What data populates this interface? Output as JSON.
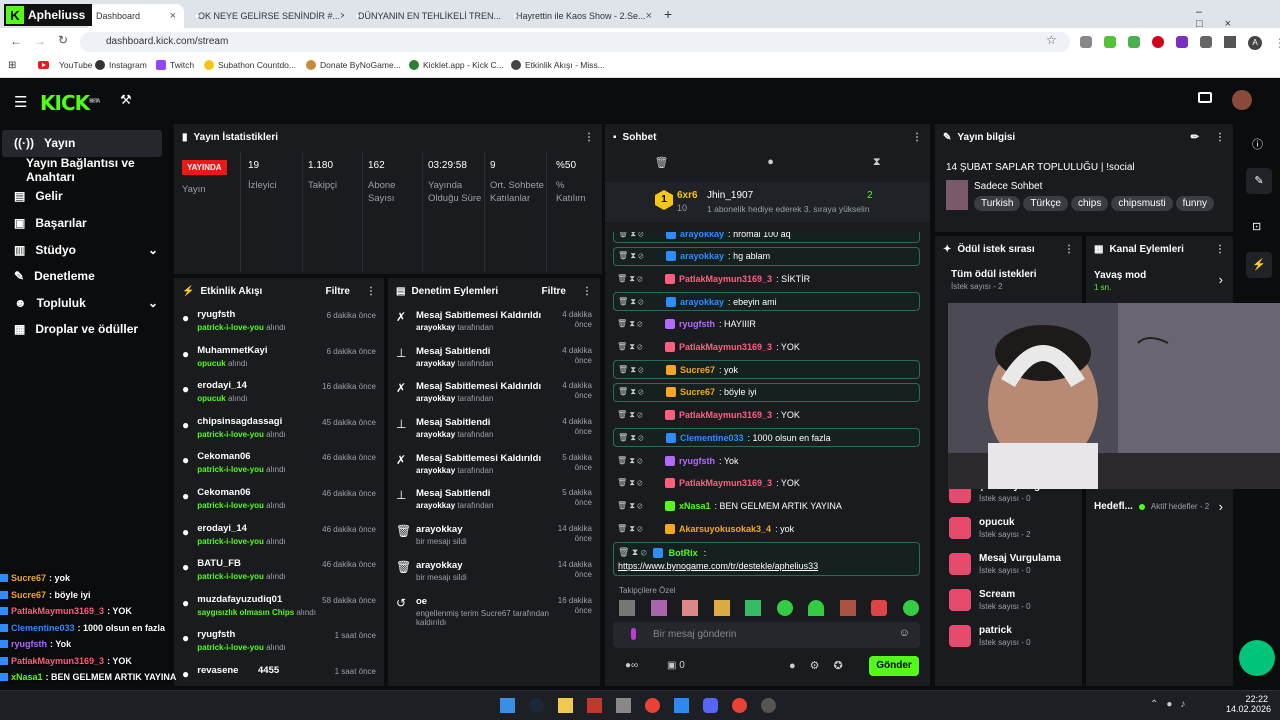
{
  "browser": {
    "tabs": [
      {
        "label": "Dashboard",
        "channel_badge": "Apheliuss",
        "active": true
      },
      {
        "label": "OK NEYE GELİRSE SENİNDİR #..."
      },
      {
        "label": "DÜNYANIN EN TEHLİKELİ TREN..."
      },
      {
        "label": "Hayrettin ile Kaos Show - 2.Se..."
      }
    ],
    "url": "dashboard.kick.com/stream",
    "bookmarks": [
      "YouTube",
      "Instagram",
      "Twitch",
      "Subathon Countdo...",
      "Donate ByNoGame...",
      "Kicklet.app - Kick C...",
      "Etkinlik Akışı - Miss..."
    ]
  },
  "kick": {
    "logo": "KICK",
    "beta": "BETA"
  },
  "nav": [
    {
      "label": "Yayın",
      "icon": "broadcast-icon",
      "active": true
    },
    {
      "label": "Yayın Bağlantısı ve Anahtarı",
      "icon": ""
    },
    {
      "label": "Gelir",
      "icon": "revenue-icon"
    },
    {
      "label": "Başarılar",
      "icon": "trophy-icon"
    },
    {
      "label": "Stüdyo",
      "icon": "studio-icon",
      "expand": true
    },
    {
      "label": "Denetleme",
      "icon": "wrench-icon"
    },
    {
      "label": "Topluluk",
      "icon": "users-icon",
      "expand": true
    },
    {
      "label": "Droplar ve ödüller",
      "icon": "gift-icon"
    }
  ],
  "stats": {
    "title": "Yayın İstatistikleri",
    "live_badge": "YAYINDA",
    "live_label": "Yayın",
    "items": [
      {
        "value": "19",
        "label": "İzleyici"
      },
      {
        "value": "1.180",
        "label": "Takipçi"
      },
      {
        "value": "162",
        "label": "Abone Sayısı"
      },
      {
        "value": "03:29:58",
        "label": "Yayında Olduğu Süre"
      },
      {
        "value": "9",
        "label": "Ort. Sohbete Katılanlar"
      },
      {
        "value": "%50",
        "label": "% Katılım"
      }
    ]
  },
  "activity": {
    "title": "Etkinlik Akışı",
    "filter": "Filtre",
    "items": [
      {
        "name": "ryugfsth",
        "reward": "patrick-i-love-you",
        "suffix": "alındı",
        "time": "6 dakika önce"
      },
      {
        "name": "MuhammetKayi",
        "reward": "opucuk",
        "suffix": "alındı",
        "time": "6 dakika önce"
      },
      {
        "name": "erodayi_14",
        "reward": "opucuk",
        "suffix": "alındı",
        "time": "16 dakika önce"
      },
      {
        "name": "chipsinsagdassagi",
        "reward": "patrick-i-love-you",
        "suffix": "alındı",
        "time": "45 dakika önce"
      },
      {
        "name": "Cekoman06",
        "reward": "patrick-i-love-you",
        "suffix": "alındı",
        "time": "46 dakika önce"
      },
      {
        "name": "Cekoman06",
        "reward": "patrick-i-love-you",
        "suffix": "alındı",
        "time": "46 dakika önce"
      },
      {
        "name": "erodayi_14",
        "reward": "patrick-i-love-you",
        "suffix": "alındı",
        "time": "46 dakika önce"
      },
      {
        "name": "BATU_FB",
        "reward": "patrick-i-love-you",
        "suffix": "alındı",
        "time": "46 dakika önce"
      },
      {
        "name": "muzdafayuzudiq01",
        "reward": "saygısızlık olmasın Chips",
        "suffix": "alındı",
        "time": "58 dakika önce"
      },
      {
        "name": "ryugfsth",
        "reward": "patrick-i-love-you",
        "suffix": "alındı",
        "time": "1 saat önce"
      },
      {
        "name": "revasene",
        "extra": "4455",
        "reward": "",
        "suffix": "",
        "time": "1 saat önce"
      }
    ]
  },
  "moderation": {
    "title": "Denetim Eylemleri",
    "filter": "Filtre",
    "items": [
      {
        "action": "Mesaj Sabitlemesi Kaldırıldı",
        "by": "arayokkay",
        "suffix": "tarafından",
        "time": "4 dakika önce",
        "icon": "unpin-icon"
      },
      {
        "action": "Mesaj Sabitlendi",
        "by": "arayokkay",
        "suffix": "tarafından",
        "time": "4 dakika önce",
        "icon": "pin-icon"
      },
      {
        "action": "Mesaj Sabitlemesi Kaldırıldı",
        "by": "arayokkay",
        "suffix": "tarafından",
        "time": "4 dakika önce",
        "icon": "unpin-icon"
      },
      {
        "action": "Mesaj Sabitlendi",
        "by": "arayokkay",
        "suffix": "tarafından",
        "time": "4 dakika önce",
        "icon": "pin-icon"
      },
      {
        "action": "Mesaj Sabitlemesi Kaldırıldı",
        "by": "arayokkay",
        "suffix": "tarafından",
        "time": "5 dakika önce",
        "icon": "unpin-icon"
      },
      {
        "action": "Mesaj Sabitlendi",
        "by": "arayokkay",
        "suffix": "tarafından",
        "time": "5 dakika önce",
        "icon": "pin-icon"
      },
      {
        "action": "arayokkay",
        "by": "",
        "suffix": "bir mesajı sildi",
        "time": "14 dakika önce",
        "icon": "trash-icon"
      },
      {
        "action": "arayokkay",
        "by": "",
        "suffix": "bir mesajı sildi",
        "time": "14 dakika önce",
        "icon": "trash-icon"
      },
      {
        "action": "oe",
        "by": "",
        "suffix": "engellenmiş terim Sucre67 tarafından kaldırıldı",
        "time": "16 dakika önce",
        "icon": "undo-icon"
      }
    ]
  },
  "chat": {
    "title": "Sohbet",
    "leader": {
      "rank": "1",
      "count": "6xr6",
      "sub": "10",
      "name": "Jhin_1907",
      "gifts": "2",
      "note": "1 abonelik hediye ederek 3. sıraya yükselin"
    },
    "messages": [
      {
        "user": "arayokkay",
        "text": "hromal 100 aq",
        "color": "#2f8cff",
        "hl": true
      },
      {
        "user": "arayokkay",
        "text": "hg ablam",
        "color": "#2f8cff",
        "hl": true
      },
      {
        "user": "PatlakMaymun3169_3",
        "text": "SİKTİR",
        "color": "#ff5f7e",
        "hl": false
      },
      {
        "user": "arayokkay",
        "text": "ebeyin ami",
        "color": "#2f8cff",
        "hl": true
      },
      {
        "user": "ryugfsth",
        "text": "HAYIIIR",
        "color": "#b36bff",
        "hl": false
      },
      {
        "user": "PatlakMaymun3169_3",
        "text": "YOK",
        "color": "#ff5f7e",
        "hl": false
      },
      {
        "user": "Sucre67",
        "text": "yok",
        "color": "#f6a623",
        "hl": true
      },
      {
        "user": "Sucre67",
        "text": "böyle iyi",
        "color": "#f6a623",
        "hl": true
      },
      {
        "user": "PatlakMaymun3169_3",
        "text": "YOK",
        "color": "#ff5f7e",
        "hl": false
      },
      {
        "user": "Clementine033",
        "text": "1000 olsun en fazla",
        "color": "#2f8cff",
        "hl": true
      },
      {
        "user": "ryugfsth",
        "text": "Yok",
        "color": "#b36bff",
        "hl": false
      },
      {
        "user": "PatlakMaymun3169_3",
        "text": "YOK",
        "color": "#ff5f7e",
        "hl": false
      },
      {
        "user": "xNasa1",
        "text": "BEN GELMEM ARTIK YAYINA",
        "color": "#53fc18",
        "hl": false
      },
      {
        "user": "Akarsuyokusokak3_4",
        "text": "yok",
        "color": "#f6a623",
        "hl": false
      }
    ],
    "bot": {
      "user": "BotRix",
      "text": "https://www.bynogame.com/tr/destekle/aphelius33"
    },
    "emote_label": "Takipçilere Özel",
    "input_placeholder": "Bir mesaj gönderin",
    "points": "0",
    "send": "Gönder"
  },
  "info": {
    "title": "Yayın bilgisi",
    "stream_title": "14 ŞUBAT SAPLAR TOPLULUĞU | !social",
    "category": "Sadece Sohbet",
    "tags": [
      "Turkish",
      "Türkçe",
      "chips",
      "chipsmusti",
      "funny"
    ]
  },
  "rewards": {
    "title": "Ödül istek sırası",
    "all": "Tüm ödül istekleri",
    "all_count": "İstek sayısı - 2",
    "items": [
      {
        "name": "çok da yaragımda",
        "count": "İstek sayısı - 0"
      },
      {
        "name": "opucuk",
        "count": "İstek sayısı - 2"
      },
      {
        "name": "Mesaj Vurgulama",
        "count": "İstek sayısı - 0"
      },
      {
        "name": "Scream",
        "count": "İstek sayısı - 0"
      },
      {
        "name": "patrick",
        "count": "İstek sayısı - 0"
      }
    ]
  },
  "kanal": {
    "title": "Kanal Eylemleri",
    "slow": "Yavaş mod",
    "slow_val": "1 sn.",
    "goals": "Hedefl...",
    "goals_status": "Aktif hedefler - 2"
  },
  "overlay": [
    {
      "user": "Sucre67",
      "text": ": yok",
      "color": "#f6a623"
    },
    {
      "user": "Sucre67",
      "text": ": böyle iyi",
      "color": "#f6a623"
    },
    {
      "user": "PatlakMaymun3169_3",
      "text": ": YOK",
      "color": "#ff5f7e"
    },
    {
      "user": "Clementine033",
      "text": ": 1000 olsun en fazla",
      "color": "#2f8cff"
    },
    {
      "user": "ryugfsth",
      "text": ": Yok",
      "color": "#b36bff"
    },
    {
      "user": "PatlakMaymun3169_3",
      "text": ": YOK",
      "color": "#ff5f7e"
    },
    {
      "user": "xNasa1",
      "text": ": BEN GELMEM ARTIK YAYINA",
      "color": "#53fc18"
    },
    {
      "user": "Akarsuyokusokak3_4",
      "text": ": yok",
      "color": "#f6a623"
    },
    {
      "user": "BotRix",
      "text": ": https://www.bynogame.com/tr/destekle/aphelius33",
      "color": "#53fc18"
    }
  ],
  "taskbar": {
    "time": "22:22",
    "date": "14.02.2026"
  }
}
